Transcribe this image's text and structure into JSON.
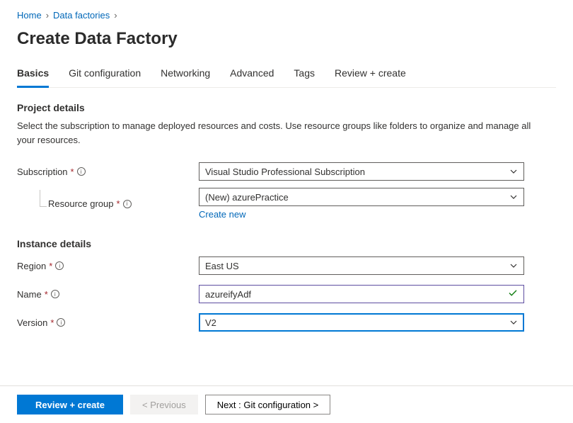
{
  "breadcrumb": {
    "home": "Home",
    "data_factories": "Data factories"
  },
  "page_title": "Create Data Factory",
  "tabs": {
    "basics": "Basics",
    "git": "Git configuration",
    "networking": "Networking",
    "advanced": "Advanced",
    "tags": "Tags",
    "review": "Review + create"
  },
  "project_details": {
    "heading": "Project details",
    "description": "Select the subscription to manage deployed resources and costs. Use resource groups like folders to organize and manage all your resources.",
    "subscription_label": "Subscription",
    "subscription_value": "Visual Studio Professional Subscription",
    "resource_group_label": "Resource group",
    "resource_group_value": "(New) azurePractice",
    "create_new": "Create new"
  },
  "instance_details": {
    "heading": "Instance details",
    "region_label": "Region",
    "region_value": "East US",
    "name_label": "Name",
    "name_value": "azureifyAdf",
    "version_label": "Version",
    "version_value": "V2"
  },
  "footer": {
    "review": "Review + create",
    "previous": "< Previous",
    "next": "Next : Git configuration >"
  }
}
